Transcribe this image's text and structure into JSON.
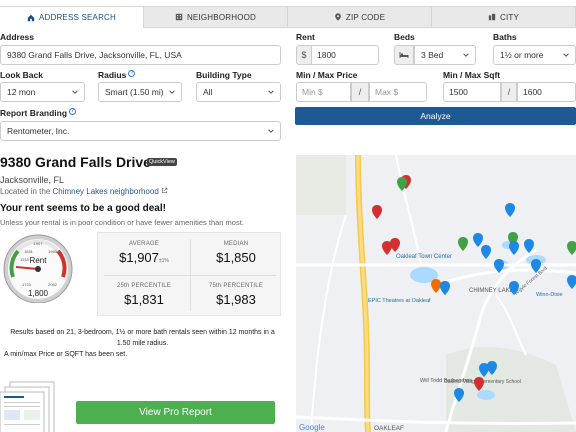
{
  "tabs": [
    {
      "label": "ADDRESS SEARCH",
      "icon": "home-icon",
      "active": true
    },
    {
      "label": "NEIGHBORHOOD",
      "icon": "building-icon",
      "active": false
    },
    {
      "label": "ZIP CODE",
      "icon": "map-pin-icon",
      "active": false
    },
    {
      "label": "CITY",
      "icon": "city-icon",
      "active": false
    }
  ],
  "form": {
    "address_label": "Address",
    "address_value": "9380 Grand Falls Drive, Jacksonville, FL, USA",
    "rent_label": "Rent",
    "rent_prefix": "$",
    "rent_value": "1800",
    "beds_label": "Beds",
    "beds_value": "3 Bed",
    "baths_label": "Baths",
    "baths_value": "1½ or more",
    "lookback_label": "Look Back",
    "lookback_value": "12 mon",
    "radius_label": "Radius",
    "radius_value": "Smart (1.50 mi)",
    "building_label": "Building Type",
    "building_value": "All",
    "price_label": "Min / Max Price",
    "price_min_placeholder": "Min $",
    "price_max_placeholder": "Max $",
    "sqft_label": "Min / Max Sqft",
    "sqft_min": "1500",
    "sqft_max": "1600",
    "slash": "/",
    "branding_label": "Report Branding",
    "branding_value": "Rentometer, Inc.",
    "analyze_label": "Analyze"
  },
  "result": {
    "title": "9380 Grand Falls Drive",
    "badge": "QuickView",
    "city": "Jacksonville, FL",
    "located_prefix": "Located in the ",
    "neighborhood": "Chimney Lakes neighborhood",
    "verdict": "Your rent seems to be a good deal!",
    "verdict_sub": "Unless your rental is in poor condition or have fewer amenities than most.",
    "gauge_label": "Rent",
    "gauge_value": "1,800",
    "gauge_ticks": [
      "1515",
      "1907",
      "2062",
      "1723",
      "1831",
      "1983"
    ],
    "stats": {
      "average_label": "AVERAGE",
      "average_value": "$1,907",
      "average_margin": "±1%",
      "median_label": "MEDIAN",
      "median_value": "$1,850",
      "p25_label": "25th PERCENTILE",
      "p25_value": "$1,831",
      "p75_label": "75th PERCENTILE",
      "p75_value": "$1,983"
    },
    "results_line1": "Results based on 21, 3-bedroom, 1½ or more bath rentals seen within 12 months in a",
    "results_line2": "1.50 mile radius.",
    "results_line3": "A min/max Price or SQFT has been set.",
    "pro_button": "View Pro Report"
  },
  "map": {
    "labels": [
      "Oakleaf Town Center",
      "EPIC Theatres at Oakleaf",
      "CHIMNEY LAKES",
      "Argyle Forest Blvd",
      "Winn-Dixie",
      "Oakleaf Village Elementary School",
      "Will Todd Barbershop",
      "OAKLEAF",
      "Google"
    ],
    "colors": {
      "red": "#d32f2f",
      "green": "#43a047",
      "blue": "#1e88e5",
      "orange": "#ef6c00"
    }
  }
}
